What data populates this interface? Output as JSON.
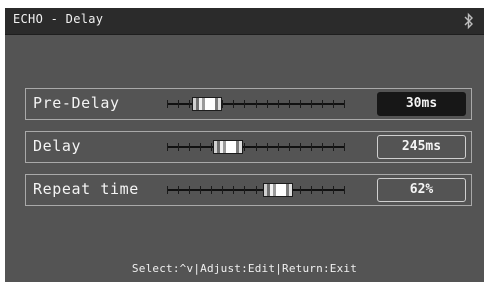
{
  "header": {
    "title": "ECHO - Delay",
    "status_icon": "bluetooth-icon"
  },
  "params": [
    {
      "label": "Pre-Delay",
      "value": "30ms",
      "level": 0.17,
      "selected": true
    },
    {
      "label": "Delay",
      "value": "245ms",
      "level": 0.31,
      "selected": false
    },
    {
      "label": "Repeat time",
      "value": "62%",
      "level": 0.65,
      "selected": false
    }
  ],
  "footer": {
    "hint": "Select:^v|Adjust:Edit|Return:Exit"
  },
  "colors": {
    "screen_bg": "#545454",
    "titlebar_bg": "#2b2b2b",
    "selected_value_bg": "#171717",
    "text": "#f4f4f4"
  }
}
